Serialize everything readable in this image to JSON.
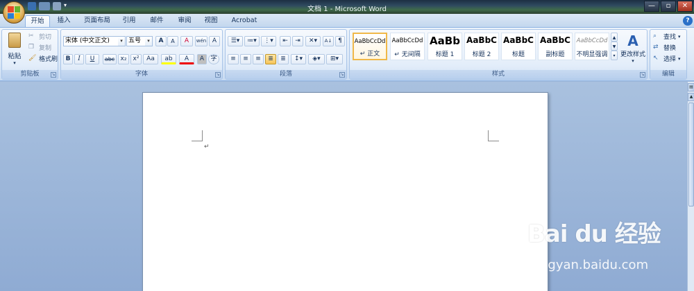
{
  "window": {
    "title": "文档 1 - Microsoft Word",
    "minimize": "—",
    "maximize": "▫",
    "close": "✕"
  },
  "tabs": [
    {
      "label": "开始"
    },
    {
      "label": "插入"
    },
    {
      "label": "页面布局"
    },
    {
      "label": "引用"
    },
    {
      "label": "邮件"
    },
    {
      "label": "审阅"
    },
    {
      "label": "视图"
    },
    {
      "label": "Acrobat"
    }
  ],
  "clipboard": {
    "paste": "粘贴",
    "cut": "剪切",
    "copy": "复制",
    "format_painter": "格式刷",
    "label": "剪贴板"
  },
  "font": {
    "family": "宋体 (中文正文)",
    "size": "五号",
    "label": "字体",
    "bold": "B",
    "italic": "I",
    "underline": "U",
    "strike": "abc",
    "sub": "x₂",
    "sup": "x²",
    "case": "Aa",
    "grow": "A",
    "shrink": "A",
    "clear": "A",
    "pinyin": "wén",
    "border": "A",
    "highlight": "ab",
    "color": "A",
    "shade": "A",
    "enclose": "字"
  },
  "paragraph": {
    "label": "段落",
    "sort": "A↓"
  },
  "styles": {
    "label": "样式",
    "items": [
      {
        "sample": "AaBbCcDd",
        "name": "↵ 正文"
      },
      {
        "sample": "AaBbCcDd",
        "name": "↵ 无间隔"
      },
      {
        "sample": "AaBb",
        "name": "标题 1"
      },
      {
        "sample": "AaBbC",
        "name": "标题 2"
      },
      {
        "sample": "AaBbC",
        "name": "标题"
      },
      {
        "sample": "AaBbC",
        "name": "副标题"
      },
      {
        "sample": "AaBbCcDd",
        "name": "不明显强调"
      }
    ],
    "change": "更改样式"
  },
  "editing": {
    "label": "编辑",
    "find": "查找",
    "replace": "替换",
    "select": "选择"
  },
  "document": {
    "paragraph_mark": "↵"
  },
  "watermark": {
    "logo": "Bai du 经验",
    "url": "jingyan.baidu.com"
  }
}
